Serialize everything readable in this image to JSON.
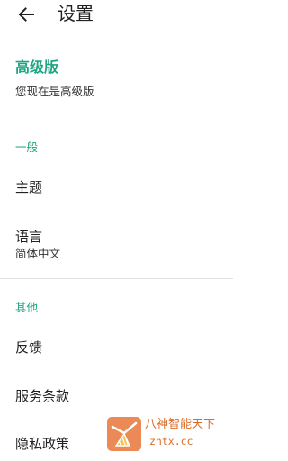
{
  "header": {
    "title": "设置",
    "back_icon": "arrow-left-icon"
  },
  "premium": {
    "title": "高级版",
    "subtitle": "您现在是高级版"
  },
  "sections": {
    "general": {
      "header": "一般",
      "theme_label": "主题",
      "language_label": "语言",
      "language_value": "简体中文"
    },
    "other": {
      "header": "其他",
      "feedback_label": "反馈",
      "terms_label": "服务条款",
      "privacy_label": "隐私政策"
    }
  },
  "watermark": {
    "name": "八神智能天下",
    "domain": "zntx.cc"
  },
  "colors": {
    "accent": "#1fa582",
    "text_primary": "#212121",
    "divider": "#e0e0e0",
    "watermark": "#d96d2a"
  }
}
